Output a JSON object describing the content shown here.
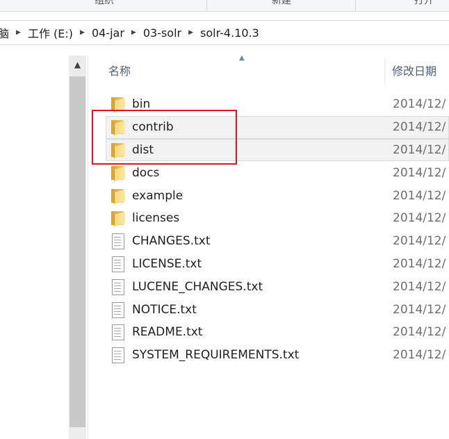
{
  "ribbon": {
    "groups": [
      "组织",
      "新建",
      "打开"
    ]
  },
  "address": {
    "crumbs": [
      "脑",
      "工作 (E:)",
      "04-jar",
      "03-solr",
      "solr-4.10.3"
    ]
  },
  "scrollbar": {
    "up_arrow": "▲"
  },
  "columns": {
    "name": "名称",
    "date": "修改日期",
    "sort_indicator": "▲"
  },
  "files": [
    {
      "name": "bin",
      "type": "folder",
      "date": "2014/12/"
    },
    {
      "name": "contrib",
      "type": "folder",
      "date": "2014/12/"
    },
    {
      "name": "dist",
      "type": "folder",
      "date": "2014/12/"
    },
    {
      "name": "docs",
      "type": "folder",
      "date": "2014/12/"
    },
    {
      "name": "example",
      "type": "folder",
      "date": "2014/12/"
    },
    {
      "name": "licenses",
      "type": "folder",
      "date": "2014/12/"
    },
    {
      "name": "CHANGES.txt",
      "type": "text",
      "date": "2014/12/"
    },
    {
      "name": "LICENSE.txt",
      "type": "text",
      "date": "2014/12/"
    },
    {
      "name": "LUCENE_CHANGES.txt",
      "type": "text",
      "date": "2014/12/"
    },
    {
      "name": "NOTICE.txt",
      "type": "text",
      "date": "2014/12/"
    },
    {
      "name": "README.txt",
      "type": "text",
      "date": "2014/12/"
    },
    {
      "name": "SYSTEM_REQUIREMENTS.txt",
      "type": "text",
      "date": "2014/12/"
    }
  ],
  "highlight_color": "#e81123"
}
